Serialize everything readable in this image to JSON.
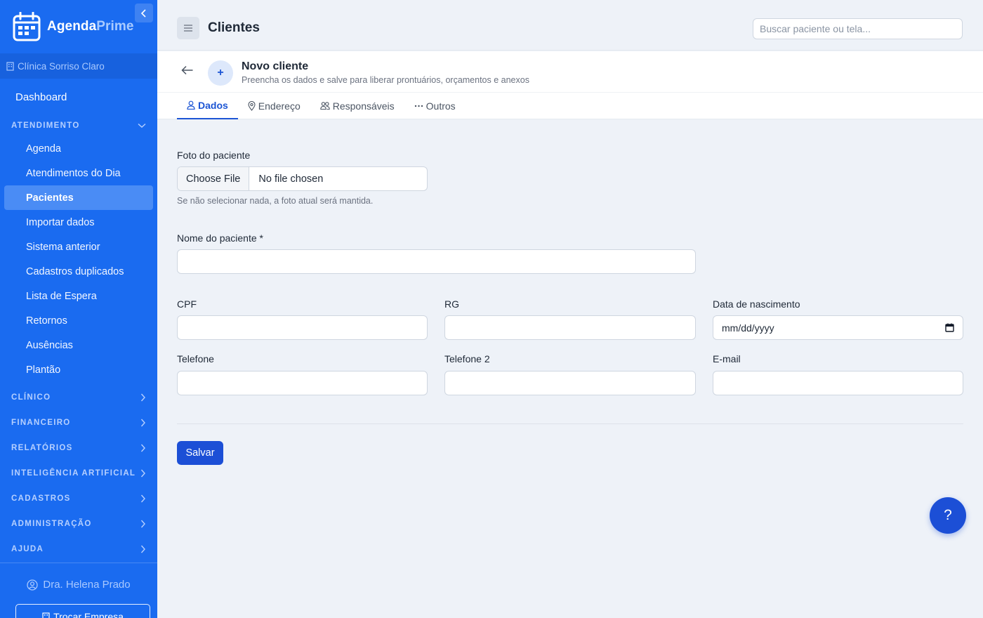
{
  "brand": {
    "name_part1": "Agenda",
    "name_part2": "Prime"
  },
  "clinic": {
    "name": "Clínica Sorriso Claro"
  },
  "sidebar": {
    "dashboard": "Dashboard",
    "atendimento": {
      "label": "ATENDIMENTO",
      "items": [
        "Agenda",
        "Atendimentos do Dia",
        "Pacientes",
        "Importar dados",
        "Sistema anterior",
        "Cadastros duplicados",
        "Lista de Espera",
        "Retornos",
        "Ausências",
        "Plantão"
      ],
      "active": "Pacientes"
    },
    "sections": [
      "CLÍNICO",
      "FINANCEIRO",
      "RELATÓRIOS",
      "INTELIGÊNCIA ARTIFICIAL",
      "CADASTROS",
      "ADMINISTRAÇÃO",
      "AJUDA"
    ],
    "user": "Dra. Helena Prado",
    "switch_company": "Trocar Empresa"
  },
  "header": {
    "title": "Clientes",
    "search_placeholder": "Buscar paciente ou tela..."
  },
  "subheader": {
    "title": "Novo cliente",
    "subtitle": "Preencha os dados e salve para liberar prontuários, orçamentos e anexos",
    "tabs": [
      "Dados",
      "Endereço",
      "Responsáveis",
      "Outros"
    ],
    "active_tab": "Dados"
  },
  "form": {
    "photo_label": "Foto do paciente",
    "file_button": "Choose File",
    "file_status": "No file chosen",
    "photo_help": "Se não selecionar nada, a foto atual será mantida.",
    "name_label": "Nome do paciente *",
    "cpf_label": "CPF",
    "rg_label": "RG",
    "birth_label": "Data de nascimento",
    "birth_placeholder": "mm/dd/yyyy",
    "phone_label": "Telefone",
    "phone2_label": "Telefone 2",
    "email_label": "E-mail",
    "save": "Salvar"
  },
  "help_fab": "?"
}
